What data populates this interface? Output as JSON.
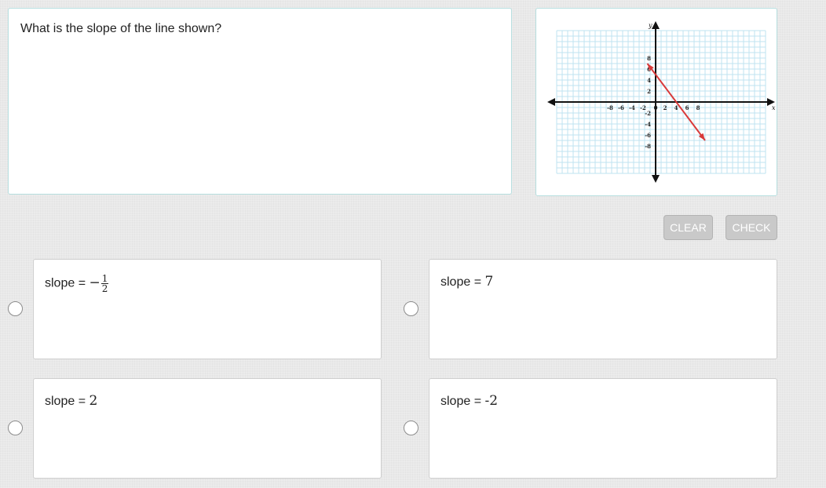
{
  "question": {
    "text": "What is the slope of the line shown?"
  },
  "graph": {
    "x_axis_label": "x",
    "y_axis_label": "y",
    "x_ticks": [
      "-8",
      "-6",
      "-4",
      "-2",
      "0",
      "2",
      "4",
      "6",
      "8"
    ],
    "y_ticks": [
      "8",
      "6",
      "4",
      "2",
      "-2",
      "-4",
      "-6",
      "-8"
    ],
    "line_color": "#d93a3a",
    "line_points": [
      [
        -1.5,
        7.0
      ],
      [
        9,
        -7.0
      ]
    ]
  },
  "buttons": {
    "clear_label": "CLEAR",
    "check_label": "CHECK"
  },
  "choices": [
    {
      "prefix": "slope = ",
      "sign": "−",
      "numerator": "1",
      "denominator": "2",
      "selected": false
    },
    {
      "prefix": "slope = ",
      "value": "7",
      "selected": false
    },
    {
      "prefix": "slope = ",
      "value": "2",
      "selected": false
    },
    {
      "prefix": "slope = ",
      "value": "-2",
      "selected": false
    }
  ],
  "colors": {
    "card_border": "#b7dfe0",
    "grid": "#bfe3f0",
    "button_bg": "#c9c9c9"
  }
}
